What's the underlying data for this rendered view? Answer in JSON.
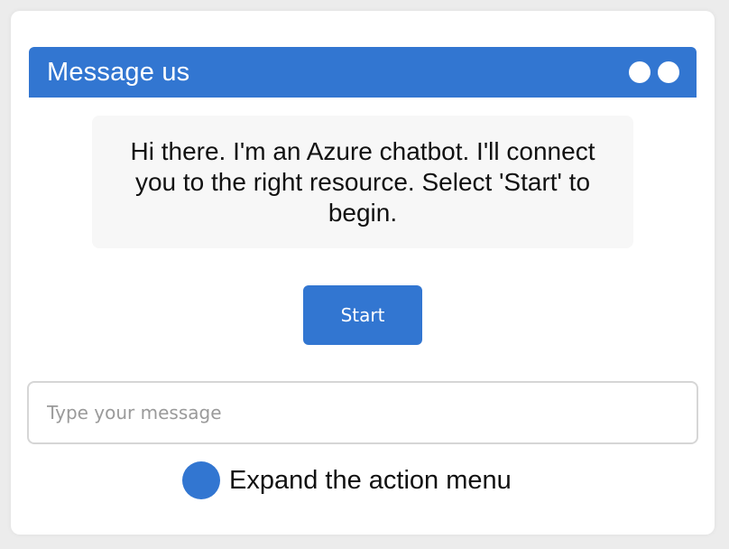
{
  "chat": {
    "header_title": "Message us",
    "welcome_message": "Hi there. I'm an Azure chatbot. I'll connect you to the right resource. Select 'Start' to begin.",
    "start_label": "Start",
    "input_placeholder": "Type your message",
    "input_value": "",
    "action_menu_label": "Expand the action menu"
  },
  "icons": {
    "header_controls": [
      "minimize-icon",
      "close-icon"
    ],
    "action_menu": "action-menu-icon"
  },
  "colors": {
    "accent": "#3276d1",
    "bubble_background": "#f7f7f7",
    "input_border": "#d6d6d6",
    "page_background": "#ececec"
  }
}
